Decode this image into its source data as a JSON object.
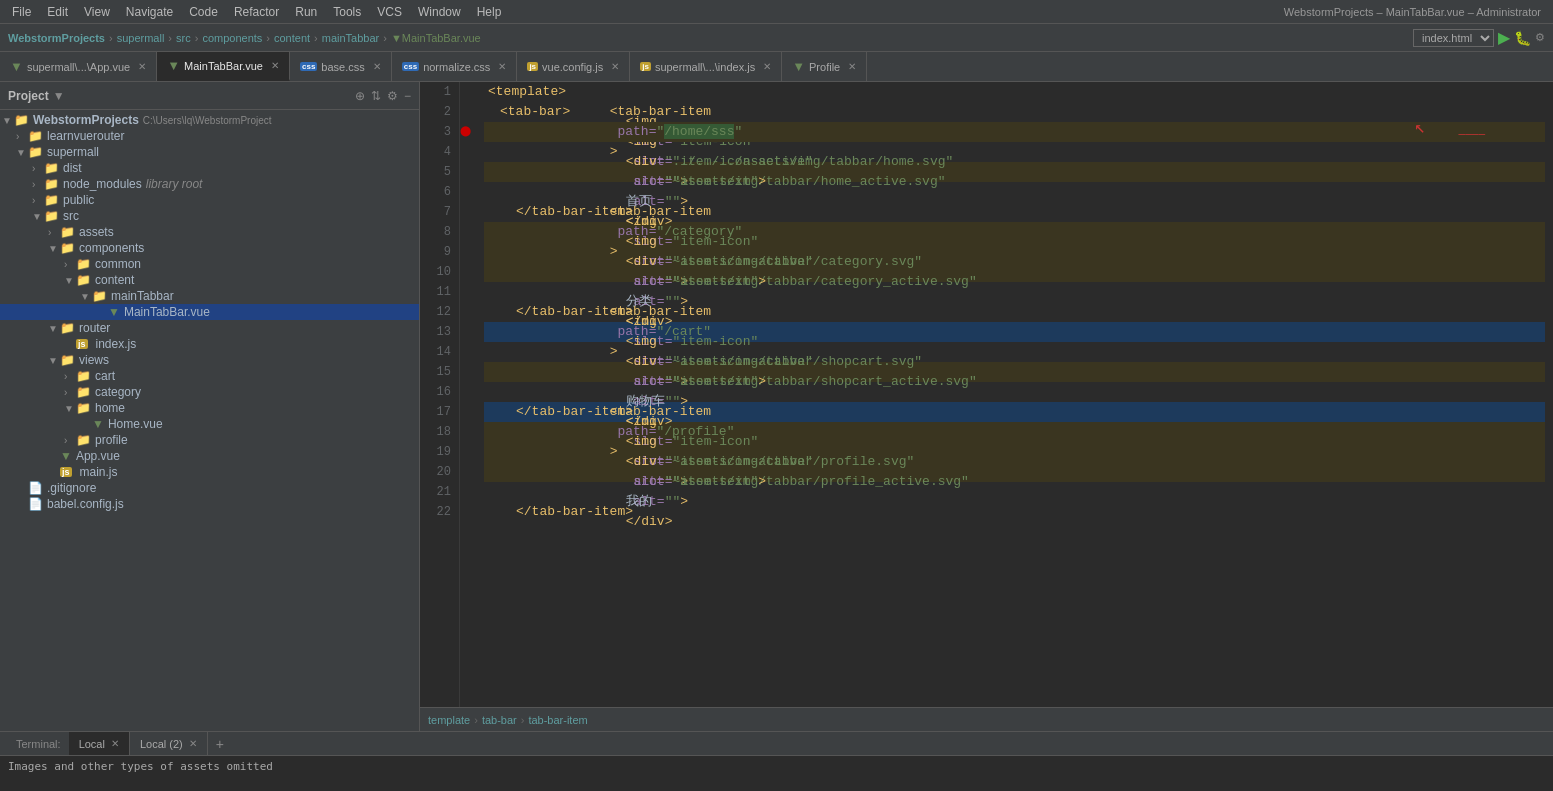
{
  "menuBar": {
    "items": [
      "File",
      "Edit",
      "View",
      "Navigate",
      "Code",
      "Refactor",
      "Run",
      "Tools",
      "VCS",
      "Window",
      "Help"
    ],
    "windowTitle": "WebstormProjects – MainTabBar.vue – Administrator"
  },
  "breadcrumb": {
    "items": [
      "WebstormProjects",
      "supermall",
      "src",
      "components",
      "content",
      "mainTabbar",
      "MainTabBar.vue"
    ],
    "rightSelect": "index.html"
  },
  "tabs": [
    {
      "id": "app-vue",
      "label": "supermall\\...\\App.vue",
      "type": "vue",
      "active": false
    },
    {
      "id": "main-tabbar",
      "label": "MainTabBar.vue",
      "type": "vue",
      "active": true
    },
    {
      "id": "base-css",
      "label": "base.css",
      "type": "css",
      "active": false
    },
    {
      "id": "normalize-css",
      "label": "normalize.css",
      "type": "css",
      "active": false
    },
    {
      "id": "vue-config",
      "label": "vue.config.js",
      "type": "js",
      "active": false
    },
    {
      "id": "supermall-index",
      "label": "supermall\\...\\index.js",
      "type": "js",
      "active": false
    },
    {
      "id": "profile",
      "label": "Profile",
      "type": "vue",
      "active": false
    }
  ],
  "projectPanel": {
    "title": "Project",
    "tree": [
      {
        "level": 0,
        "type": "root",
        "label": "WebstormProjects",
        "suffix": "C:\\Users\\lq\\WebstormProject",
        "open": true
      },
      {
        "level": 1,
        "type": "folder",
        "label": "learnvuerouter",
        "open": false
      },
      {
        "level": 1,
        "type": "folder",
        "label": "supermall",
        "open": true
      },
      {
        "level": 2,
        "type": "folder",
        "label": "dist",
        "open": false
      },
      {
        "level": 2,
        "type": "folder-lib",
        "label": "node_modules",
        "libLabel": "library root",
        "open": false
      },
      {
        "level": 2,
        "type": "folder",
        "label": "public",
        "open": false
      },
      {
        "level": 2,
        "type": "folder",
        "label": "src",
        "open": true
      },
      {
        "level": 3,
        "type": "folder",
        "label": "assets",
        "open": false
      },
      {
        "level": 3,
        "type": "folder",
        "label": "components",
        "open": true
      },
      {
        "level": 4,
        "type": "folder",
        "label": "common",
        "open": false
      },
      {
        "level": 4,
        "type": "folder",
        "label": "content",
        "open": true
      },
      {
        "level": 5,
        "type": "folder",
        "label": "mainTabbar",
        "open": true
      },
      {
        "level": 6,
        "type": "vue",
        "label": "MainTabBar.vue",
        "selected": true
      },
      {
        "level": 3,
        "type": "folder",
        "label": "router",
        "open": true
      },
      {
        "level": 4,
        "type": "js",
        "label": "index.js"
      },
      {
        "level": 3,
        "type": "folder",
        "label": "views",
        "open": true
      },
      {
        "level": 4,
        "type": "folder",
        "label": "cart",
        "open": false
      },
      {
        "level": 4,
        "type": "folder",
        "label": "category",
        "open": false
      },
      {
        "level": 4,
        "type": "folder",
        "label": "home",
        "open": true
      },
      {
        "level": 5,
        "type": "vue",
        "label": "Home.vue"
      },
      {
        "level": 4,
        "type": "folder",
        "label": "profile",
        "open": false
      },
      {
        "level": 3,
        "type": "vue",
        "label": "App.vue"
      },
      {
        "level": 3,
        "type": "js",
        "label": "main.js"
      },
      {
        "level": 1,
        "type": "file",
        "label": ".gitignore"
      },
      {
        "level": 1,
        "type": "file",
        "label": "babel.config.js"
      }
    ]
  },
  "editor": {
    "lines": [
      {
        "num": 1,
        "content": "<template>",
        "indent": 2
      },
      {
        "num": 2,
        "content": "<tab-bar>",
        "indent": 4
      },
      {
        "num": 3,
        "content": "<tab-bar-item path=\"/home/sss\">",
        "indent": 8,
        "highlight": "yellow",
        "hasArrow": true
      },
      {
        "num": 4,
        "content": "<img slot=\"item-icon\" src=\"../../../assets/img/tabbar/home.svg\" alt=\"\">",
        "indent": 12
      },
      {
        "num": 5,
        "content": "<img slot=\"item-icon-active\" src=\"~assets/img/tabbar/home_active.svg\" alt=\"\">",
        "indent": 12,
        "highlight": "yellow"
      },
      {
        "num": 6,
        "content": "<div slot=\"item-text\">首页</div>",
        "indent": 12
      },
      {
        "num": 7,
        "content": "</tab-bar-item>",
        "indent": 8
      },
      {
        "num": 8,
        "content": "<tab-bar-item path=\"/category\">",
        "indent": 8,
        "highlight": "yellow"
      },
      {
        "num": 9,
        "content": "<img slot=\"item-icon\" src=\"~assets/img/tabbar/category.svg\" alt=\"\">",
        "indent": 12,
        "highlight": "yellow"
      },
      {
        "num": 10,
        "content": "<img slot=\"item-icon-active\" src=\"~assets/img/tabbar/category_active.svg\" alt=\"\">",
        "indent": 12,
        "highlight": "yellow"
      },
      {
        "num": 11,
        "content": "<div slot=\"item-text\">分类</div>",
        "indent": 12
      },
      {
        "num": 12,
        "content": "</tab-bar-item>",
        "indent": 8
      },
      {
        "num": 13,
        "content": "<tab-bar-item path=\"/cart\">",
        "indent": 8,
        "highlight": "blue"
      },
      {
        "num": 14,
        "content": "<img slot=\"item-icon\" src=\"~assets/img/tabbar/shopcart.svg\" alt=\"\">",
        "indent": 12
      },
      {
        "num": 15,
        "content": "<img slot=\"item-icon-active\" src=\"~assets/img/tabbar/shopcart_active.svg\" alt=\"\">",
        "indent": 12,
        "highlight": "yellow"
      },
      {
        "num": 16,
        "content": "<div slot=\"item-text\">购物车</div>",
        "indent": 12
      },
      {
        "num": 17,
        "content": "</tab-bar-item>",
        "indent": 8,
        "highlight": "blue"
      },
      {
        "num": 18,
        "content": "<tab-bar-item path=\"/profile\">",
        "indent": 8,
        "highlight": "yellow"
      },
      {
        "num": 19,
        "content": "<img slot=\"item-icon\" src=\"~assets/img/tabbar/profile.svg\" alt=\"\">",
        "indent": 12,
        "highlight": "yellow"
      },
      {
        "num": 20,
        "content": "<img slot=\"item-icon-active\" src=\"~assets/img/tabbar/profile_active.svg\" alt=\"\">",
        "indent": 12,
        "highlight": "yellow"
      },
      {
        "num": 21,
        "content": "<div slot=\"item-text\">我的</div>",
        "indent": 12
      },
      {
        "num": 22,
        "content": "</tab-bar-item>",
        "indent": 8
      }
    ],
    "breadcrumb": [
      "template",
      "tab-bar",
      "tab-bar-item"
    ]
  },
  "terminal": {
    "label": "Terminal:",
    "tabs": [
      "Local",
      "Local (2)"
    ],
    "statusText": "Images and other types of assets omitted"
  }
}
